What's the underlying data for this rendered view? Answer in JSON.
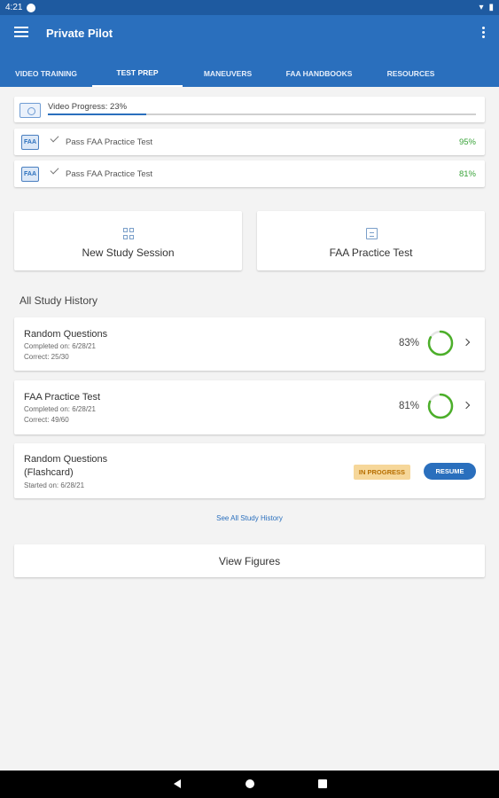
{
  "status": {
    "time": "4:21"
  },
  "app_bar": {
    "title": "Private Pilot"
  },
  "tabs": [
    {
      "label": "VIDEO TRAINING"
    },
    {
      "label": "TEST PREP"
    },
    {
      "label": "MANEUVERS"
    },
    {
      "label": "FAA HANDBOOKS"
    },
    {
      "label": "RESOURCES"
    }
  ],
  "progress": {
    "label": "Video Progress: 23%",
    "value": 0.23
  },
  "practice_tests": [
    {
      "icon": "FAA",
      "label": "Pass FAA Practice Test",
      "score": "95%"
    },
    {
      "icon": "FAA",
      "label": "Pass FAA Practice Test",
      "score": "81%"
    }
  ],
  "actions": {
    "new_study": "New Study Session",
    "faa_test": "FAA Practice Test"
  },
  "history_title": "All Study History",
  "history": [
    {
      "title": "Random Questions",
      "completed": "Completed on: 6/28/21",
      "correct": "Correct: 25/30",
      "pct": "83%",
      "ring_fraction": 0.83
    },
    {
      "title": "FAA Practice Test",
      "completed": "Completed on: 6/28/21",
      "correct": "Correct: 49/60",
      "pct": "81%",
      "ring_fraction": 0.81
    },
    {
      "title_line1": "Random Questions",
      "title_line2": "(Flashcard)",
      "started": "Started on: 6/28/21",
      "badge": "IN PROGRESS",
      "button": "RESUME"
    }
  ],
  "see_all": "See All Study History",
  "view_figures": "View Figures",
  "colors": {
    "primary": "#2a6fbd",
    "status_bar": "#1e5aa0",
    "success": "#3aa33a",
    "ring": "#4caf2a",
    "badge_bg": "#f6d79a"
  }
}
